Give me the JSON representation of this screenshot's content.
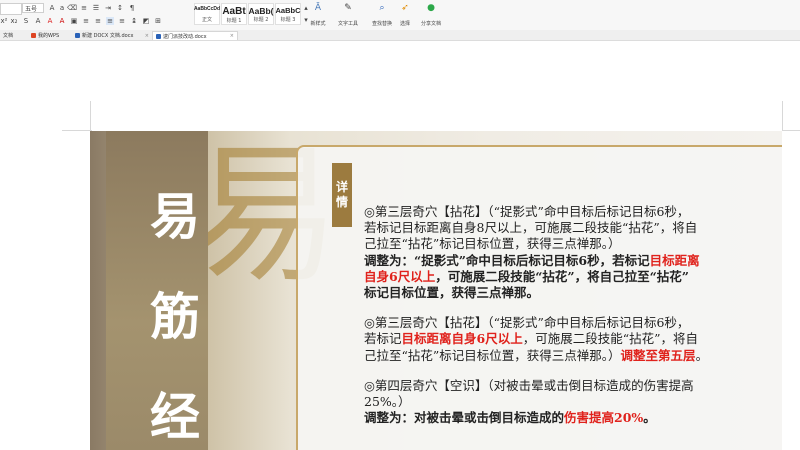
{
  "ribbon": {
    "font_name": "",
    "font_size": "五号",
    "styles": [
      {
        "preview": "AaBbCcDd",
        "label": "正文"
      },
      {
        "preview": "AaBt",
        "label": "标题 1"
      },
      {
        "preview": "AaBb(",
        "label": "标题 2"
      },
      {
        "preview": "AaBbC",
        "label": "标题 3"
      }
    ],
    "new_style": "新样式",
    "text_tools": "文字工具",
    "find_replace": "查找替换",
    "select": "选择",
    "share": "分享文档"
  },
  "tabs": [
    {
      "label": "文档"
    },
    {
      "label": "我的WPS"
    },
    {
      "label": "新建 DOCX 文档.docx"
    },
    {
      "label": "逮门派技改动.docx"
    }
  ],
  "colors": {
    "accent_red": "#e0221c",
    "panel_border": "#c8a86a",
    "tag_bg": "#9c7b3f"
  },
  "image": {
    "title_chars": [
      "易",
      "筋",
      "经"
    ],
    "bg_char": "易",
    "tag": [
      "详",
      "情"
    ],
    "paragraphs": [
      {
        "lines": [
          [
            {
              "t": "◎第三层奇穴【拈花】（“捉影式”命中目标后标记目标6秒，",
              "s": "n"
            }
          ],
          [
            {
              "t": "若标记目标距离自身8尺以上，可施展二段技能“拈花”，将自",
              "s": "n"
            }
          ],
          [
            {
              "t": "己拉至“拈花”标记目标位置，获得三点禅那。）",
              "s": "n"
            }
          ],
          [
            {
              "t": "调整为：“捉影式”命中目标后标记目标6秒，若标记",
              "s": "b"
            },
            {
              "t": "目标距离",
              "s": "r"
            }
          ],
          [
            {
              "t": "自身6尺以上",
              "s": "r"
            },
            {
              "t": "，可施展二段技能“拈花”，将自己拉至“拈花”",
              "s": "b"
            }
          ],
          [
            {
              "t": "标记目标位置，获得三点禅那。",
              "s": "b"
            }
          ]
        ]
      },
      {
        "lines": [
          [
            {
              "t": "◎第三层奇穴【拈花】（“捉影式”命中目标后标记目标6秒，",
              "s": "n"
            }
          ],
          [
            {
              "t": "若标记",
              "s": "n"
            },
            {
              "t": "目标距离自身6尺以上",
              "s": "r"
            },
            {
              "t": "，可施展二段技能“拈花”，将自",
              "s": "n"
            }
          ],
          [
            {
              "t": "己拉至“拈花”标记目标位置，获得三点禅那。）",
              "s": "n"
            },
            {
              "t": "调整至第五层",
              "s": "r"
            },
            {
              "t": "。",
              "s": "n"
            }
          ]
        ]
      },
      {
        "lines": [
          [
            {
              "t": "◎第四层奇穴【空识】（对被击晕或击倒目标造成的伤害提高",
              "s": "n"
            }
          ],
          [
            {
              "t": "25%。）",
              "s": "n"
            }
          ],
          [
            {
              "t": "调整为：对被击晕或击倒目标造成的",
              "s": "b"
            },
            {
              "t": "伤害提高20%",
              "s": "r"
            },
            {
              "t": "。",
              "s": "b"
            }
          ]
        ]
      }
    ]
  }
}
